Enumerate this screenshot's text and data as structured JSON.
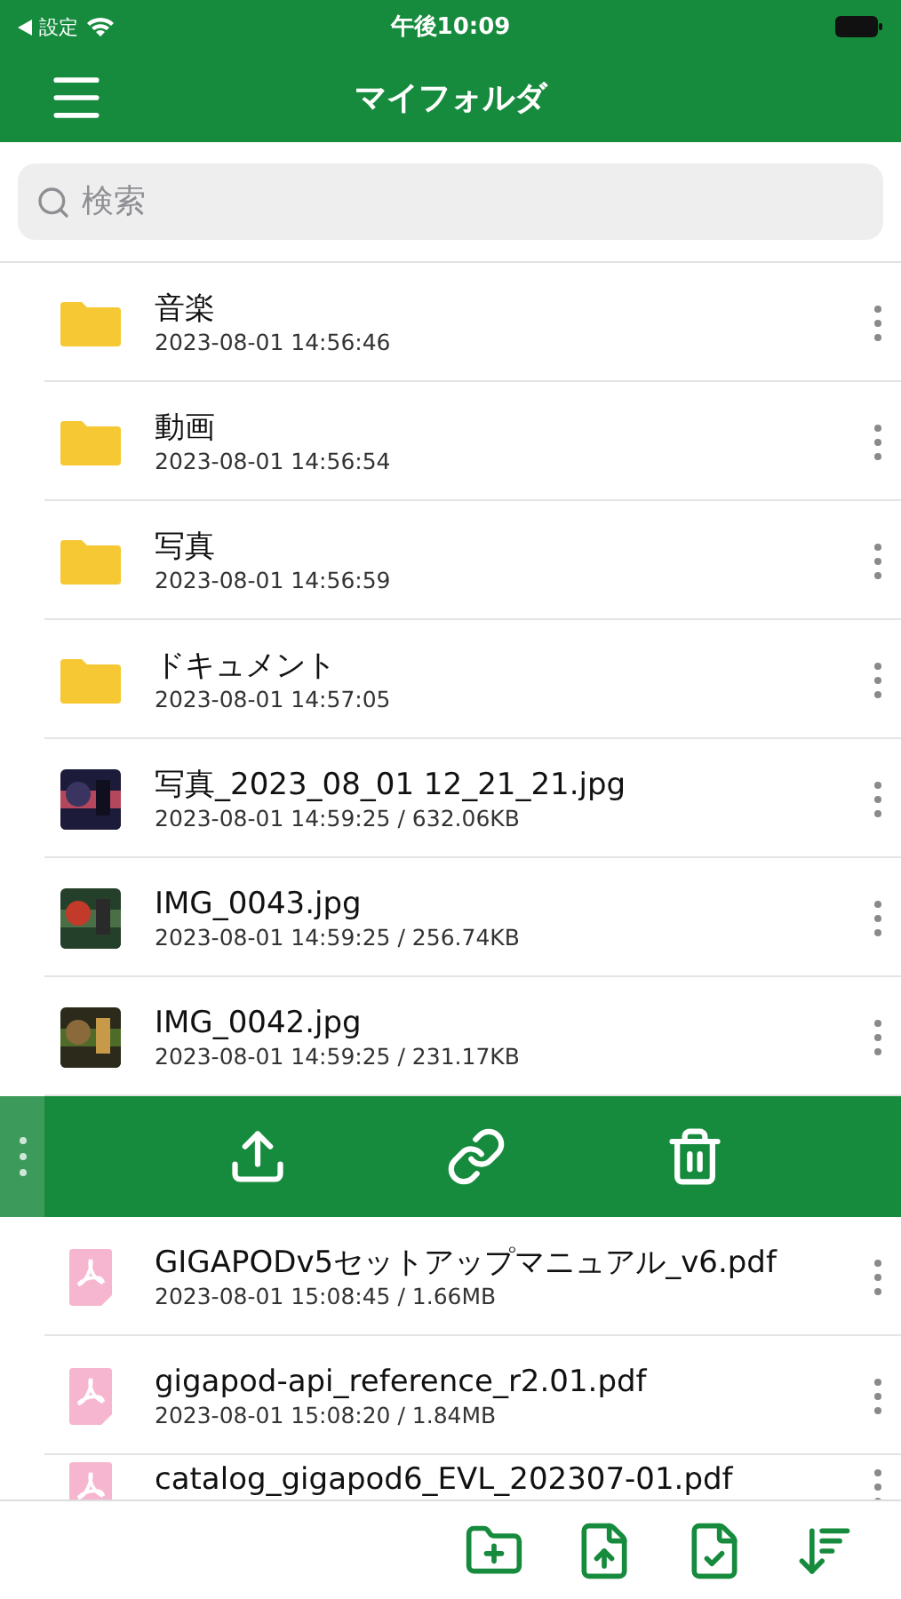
{
  "status_bar": {
    "back_label": "設定",
    "time": "午後10:09"
  },
  "nav_bar": {
    "title": "マイフォルダ"
  },
  "search": {
    "placeholder": "検索"
  },
  "items_above": [
    {
      "kind": "folder",
      "name": "音楽",
      "meta": "2023-08-01 14:56:46"
    },
    {
      "kind": "folder",
      "name": "動画",
      "meta": "2023-08-01 14:56:54"
    },
    {
      "kind": "folder",
      "name": "写真",
      "meta": "2023-08-01 14:56:59"
    },
    {
      "kind": "folder",
      "name": "ドキュメント",
      "meta": "2023-08-01 14:57:05"
    },
    {
      "name": "写真_2023_08_01 12_21_21.jpg",
      "meta": "2023-08-01 14:59:25 / 632.06KB"
    },
    {
      "name": "IMG_0043.jpg",
      "meta": "2023-08-01 14:59:25 / 256.74KB"
    },
    {
      "name": "IMG_0042.jpg",
      "meta": "2023-08-01 14:59:25 / 231.17KB"
    }
  ],
  "action_bar": {
    "actions": [
      {
        "kind": "share"
      },
      {
        "kind": "link"
      },
      {
        "kind": "delete"
      }
    ]
  },
  "items_below": [
    {
      "kind": "pdf",
      "name": "GIGAPODv5セットアップマニュアル_v6.pdf",
      "meta": "2023-08-01 15:08:45 / 1.66MB"
    },
    {
      "kind": "pdf",
      "name": "gigapod-api_reference_r2.01.pdf",
      "meta": "2023-08-01 15:08:20 / 1.84MB"
    },
    {
      "kind": "pdf",
      "name": "catalog_gigapod6_EVL_202307-01.pdf"
    }
  ],
  "toolbar": [
    {
      "kind": "new_folder"
    },
    {
      "kind": "upload"
    },
    {
      "kind": "select"
    },
    {
      "kind": "sort"
    }
  ]
}
